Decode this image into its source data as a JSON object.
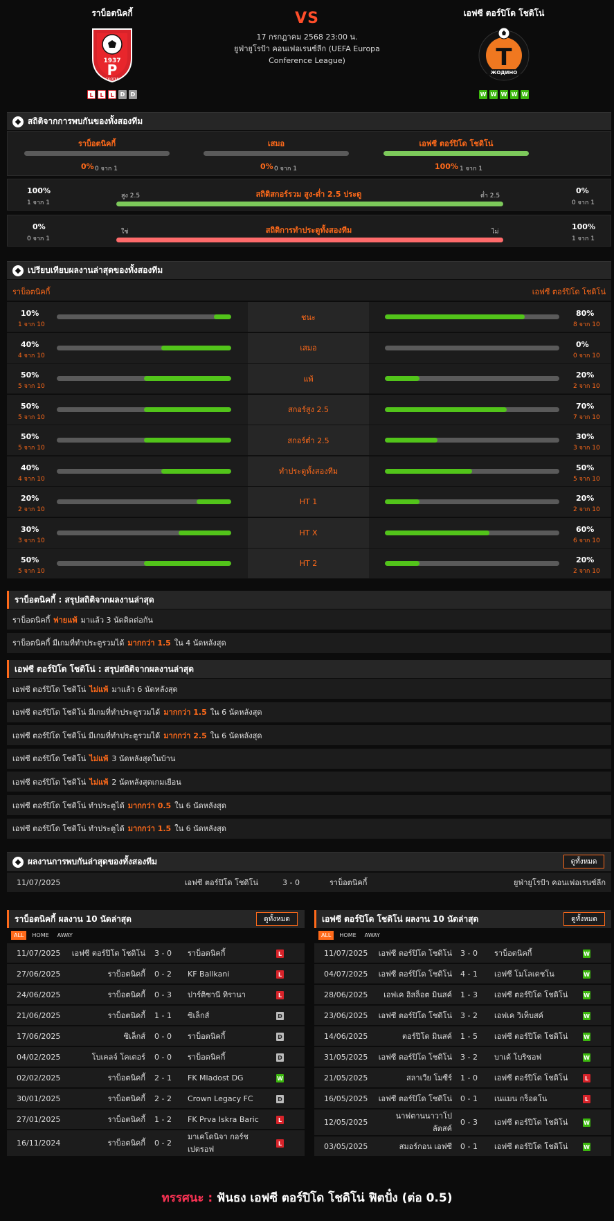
{
  "match": {
    "home_name": "ราบ็อตนิคกี้",
    "away_name": "เอฟซี ตอร์ปิโด โชดิโน่",
    "vs": "VS",
    "date": "17 กรกฎาคม 2568 23:00 น.",
    "league_line1": "ยูฟ่ายูโรป้า คอนเฟอเรนซ์ลีก (UEFA Europa",
    "league_line2": "Conference League)",
    "home_form": [
      "L",
      "L",
      "L",
      "D",
      "D"
    ],
    "away_form": [
      "W",
      "W",
      "W",
      "W",
      "W"
    ],
    "home_logo_text": [
      "1937",
      "СКОПЈЕ",
      "Р"
    ],
    "away_logo_text": [
      "Т",
      "ЖОДИНО"
    ]
  },
  "colors": {
    "accent": "#ff6a1a",
    "green": "#5bc236",
    "red": "#ff6b6b",
    "bar_bg": "#5a5a5a"
  },
  "h2h": {
    "title": "สถิติจากการพบกันของทั้งสองทีม",
    "items": [
      {
        "label": "ราบ็อตนิคกี้",
        "pct": "0%",
        "sub": "0 จาก 1",
        "value": 0
      },
      {
        "label": "เสมอ",
        "pct": "0%",
        "sub": "0 จาก 1",
        "value": 0
      },
      {
        "label": "เอฟซี ตอร์ปิโด โชดิโน่",
        "pct": "100%",
        "sub": "1 จาก 1",
        "value": 100
      }
    ],
    "ou": {
      "title": "สถิติสกอร์รวม สูง-ต่ำ 2.5 ประตู",
      "left_pct": "100%",
      "left_sub": "1 จาก 1",
      "left_label": "สูง 2.5",
      "right_label": "ต่ำ 2.5",
      "right_pct": "0%",
      "right_sub": "0 จาก 1",
      "value": 100
    },
    "btts": {
      "title": "สถิติการทำประตูทั้งสองทีม",
      "left_pct": "0%",
      "left_sub": "0 จาก 1",
      "left_label": "ใช่",
      "right_label": "ไม่",
      "right_pct": "100%",
      "right_sub": "1 จาก 1",
      "value": 0
    }
  },
  "compare": {
    "title": "เปรียบเทียบผลงานล่าสุดของทั้งสองทีม",
    "home": "ราบ็อตนิคกี้",
    "away": "เอฟซี ตอร์ปิโด โชดิโน่",
    "rows": [
      {
        "label": "ชนะ",
        "hp": "10%",
        "hs": "1 จาก 10",
        "hv": 10,
        "ap": "80%",
        "as": "8 จาก 10",
        "av": 80
      },
      {
        "label": "เสมอ",
        "hp": "40%",
        "hs": "4 จาก 10",
        "hv": 40,
        "ap": "0%",
        "as": "0 จาก 10",
        "av": 0
      },
      {
        "label": "แพ้",
        "hp": "50%",
        "hs": "5 จาก 10",
        "hv": 50,
        "ap": "20%",
        "as": "2 จาก 10",
        "av": 20
      },
      {
        "label": "สกอร์สูง 2.5",
        "hp": "50%",
        "hs": "5 จาก 10",
        "hv": 50,
        "ap": "70%",
        "as": "7 จาก 10",
        "av": 70
      },
      {
        "label": "สกอร์ต่ำ 2.5",
        "hp": "50%",
        "hs": "5 จาก 10",
        "hv": 50,
        "ap": "30%",
        "as": "3 จาก 10",
        "av": 30
      },
      {
        "label": "ทำประตูทั้งสองทีม",
        "hp": "40%",
        "hs": "4 จาก 10",
        "hv": 40,
        "ap": "50%",
        "as": "5 จาก 10",
        "av": 50
      },
      {
        "label": "HT 1",
        "hp": "20%",
        "hs": "2 จาก 10",
        "hv": 20,
        "ap": "20%",
        "as": "2 จาก 10",
        "av": 20
      },
      {
        "label": "HT X",
        "hp": "30%",
        "hs": "3 จาก 10",
        "hv": 30,
        "ap": "60%",
        "as": "6 จาก 10",
        "av": 60
      },
      {
        "label": "HT 2",
        "hp": "50%",
        "hs": "5 จาก 10",
        "hv": 50,
        "ap": "20%",
        "as": "2 จาก 10",
        "av": 20
      }
    ]
  },
  "home_summary": {
    "title": "ราบ็อตนิคกี้ : สรุปสถิติจากผลงานล่าสุด",
    "rows": [
      [
        "ราบ็อตนิคกี้",
        "พ่ายแพ้",
        "มาแล้ว 3 นัดติดต่อกัน"
      ],
      [
        "ราบ็อตนิคกี้  มีเกมที่ทำประตูรวมได้",
        "มากกว่า  1.5",
        "ใน 4 นัดหลังสุด"
      ]
    ]
  },
  "away_summary": {
    "title": "เอฟซี ตอร์ปิโด โชดิโน่ : สรุปสถิติจากผลงานล่าสุด",
    "rows": [
      [
        "เอฟซี ตอร์ปิโด โชดิโน่",
        "ไม่แพ้",
        "มาแล้ว 6 นัดหลังสุด"
      ],
      [
        "เอฟซี ตอร์ปิโด โชดิโน่  มีเกมที่ทำประตูรวมได้",
        "มากกว่า  1.5",
        "ใน 6 นัดหลังสุด"
      ],
      [
        "เอฟซี ตอร์ปิโด โชดิโน่  มีเกมที่ทำประตูรวมได้",
        "มากกว่า  2.5",
        "ใน 6 นัดหลังสุด"
      ],
      [
        "เอฟซี ตอร์ปิโด โชดิโน่",
        "ไม่แพ้",
        "3  นัดหลังสุดในบ้าน"
      ],
      [
        "เอฟซี ตอร์ปิโด โชดิโน่",
        "ไม่แพ้",
        "2  นัดหลังสุดเกมเยือน"
      ],
      [
        "เอฟซี ตอร์ปิโด โชดิโน่  ทำประตูได้",
        "มากกว่า  0.5",
        "ใน 6 นัดหลังสุด"
      ],
      [
        "เอฟซี ตอร์ปิโด โชดิโน่  ทำประตูได้",
        "มากกว่า  1.5",
        "ใน 6 นัดหลังสุด"
      ]
    ]
  },
  "h2h_results": {
    "title": "ผลงานการพบกันล่าสุดของทั้งสองทีม",
    "view_all": "ดูทั้งหมด",
    "rows": [
      {
        "date": "11/07/2025",
        "home": "เอฟซี ตอร์ปิโด โชดิโน่",
        "score": "3 - 0",
        "away": "ราบ็อตนิคกี้",
        "comp": "ยูฟ่ายูโรป้า คอนเฟอเรนซ์ลีก"
      }
    ]
  },
  "tabs": [
    "ALL",
    "HOME",
    "AWAY"
  ],
  "home_last10": {
    "title": "ราบ็อตนิคกี้ ผลงาน 10 นัดล่าสุด",
    "view_all": "ดูทั้งหมด",
    "rows": [
      {
        "date": "11/07/2025",
        "home": "เอฟซี ตอร์ปิโด โชดิโน่",
        "score": "3 - 0",
        "away": "ราบ็อตนิคกี้",
        "r": "L"
      },
      {
        "date": "27/06/2025",
        "home": "ราบ็อตนิคกี้",
        "score": "0 - 2",
        "away": "KF Ballkani",
        "r": "L"
      },
      {
        "date": "24/06/2025",
        "home": "ราบ็อตนิคกี้",
        "score": "0 - 3",
        "away": "ปาร์ติซานี ทิรานา",
        "r": "L"
      },
      {
        "date": "21/06/2025",
        "home": "ราบ็อตนิคกี้",
        "score": "1 - 1",
        "away": "ซิเล็กส์",
        "r": "D"
      },
      {
        "date": "17/06/2025",
        "home": "ซิเล็กส์",
        "score": "0 - 0",
        "away": "ราบ็อตนิคกี้",
        "r": "D"
      },
      {
        "date": "04/02/2025",
        "home": "โบเคลจ์ โคเตอร์",
        "score": "0 - 0",
        "away": "ราบ็อตนิคกี้",
        "r": "D"
      },
      {
        "date": "02/02/2025",
        "home": "ราบ็อตนิคกี้",
        "score": "2 - 1",
        "away": "FK Mladost DG",
        "r": "W"
      },
      {
        "date": "30/01/2025",
        "home": "ราบ็อตนิคกี้",
        "score": "2 - 2",
        "away": "Crown Legacy FC",
        "r": "D"
      },
      {
        "date": "27/01/2025",
        "home": "ราบ็อตนิคกี้",
        "score": "1 - 2",
        "away": "FK Prva Iskra Baric",
        "r": "L"
      },
      {
        "date": "16/11/2024",
        "home": "ราบ็อตนิคกี้",
        "score": "0 - 2",
        "away": "มาเคโดนิจา กอร์ช",
        "away2": "เปตรอฟ",
        "r": "L"
      }
    ]
  },
  "away_last10": {
    "title": "เอฟซี ตอร์ปิโด โชดิโน่ ผลงาน 10 นัดล่าสุด",
    "view_all": "ดูทั้งหมด",
    "rows": [
      {
        "date": "11/07/2025",
        "home": "เอฟซี ตอร์ปิโด โชดิโน่",
        "score": "3 - 0",
        "away": "ราบ็อตนิคกี้",
        "r": "W"
      },
      {
        "date": "04/07/2025",
        "home": "เอฟซี ตอร์ปิโด โชดิโน่",
        "score": "4 - 1",
        "away": "เอฟซี โมโลเดชโน",
        "r": "W"
      },
      {
        "date": "28/06/2025",
        "home": "เอฟเค อิสล็อต มินสค์",
        "score": "1 - 3",
        "away": "เอฟซี ตอร์ปิโด โชดิโน่",
        "r": "W"
      },
      {
        "date": "23/06/2025",
        "home": "เอฟซี ตอร์ปิโด โชดิโน่",
        "score": "3 - 2",
        "away": "เอฟเค วิเท็บสค์",
        "r": "W"
      },
      {
        "date": "14/06/2025",
        "home": "ตอร์ปิโด มินสค์",
        "score": "1 - 5",
        "away": "เอฟซี ตอร์ปิโด โชดิโน่",
        "r": "W"
      },
      {
        "date": "31/05/2025",
        "home": "เอฟซี ตอร์ปิโด โชดิโน่",
        "score": "3 - 2",
        "away": "บาเต้ โบริซอฟ",
        "r": "W"
      },
      {
        "date": "21/05/2025",
        "home": "สลาเวีย โมซีร์",
        "score": "1 - 0",
        "away": "เอฟซี ตอร์ปิโด โชดิโน่",
        "r": "L"
      },
      {
        "date": "16/05/2025",
        "home": "เอฟซี ตอร์ปิโด โชดิโน่",
        "score": "0 - 1",
        "away": "เนแมน กร็อดโน",
        "r": "L"
      },
      {
        "date": "12/05/2025",
        "home": "นาฟตานนาวาโป",
        "home2": "ลัตสค์",
        "score": "0 - 3",
        "away": "เอฟซี ตอร์ปิโด โชดิโน่",
        "r": "W"
      },
      {
        "date": "03/05/2025",
        "home": "สมอร์กอน เอฟซี",
        "score": "0 - 1",
        "away": "เอฟซี ตอร์ปิโด โชดิโน่",
        "r": "W"
      }
    ]
  },
  "verdict": {
    "label": "ทรรศนะ :",
    "text": "ฟันธง เอฟซี ตอร์ปิโด โชดิโน่ ฟิตปั๋ง (ต่อ 0.5)"
  }
}
